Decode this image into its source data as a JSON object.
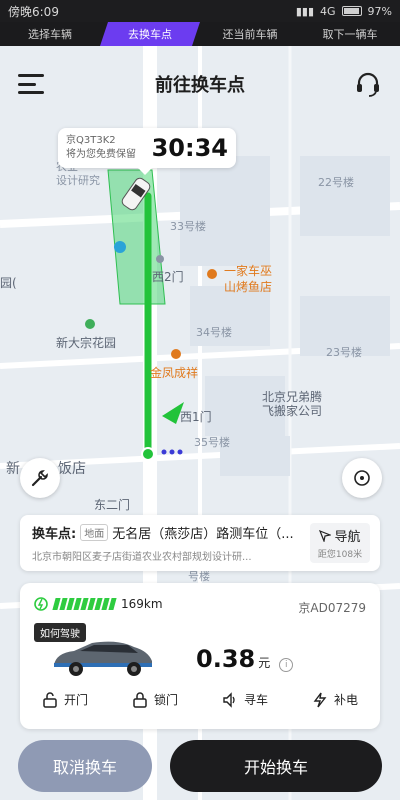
{
  "status_bar": {
    "time": "傍晚6:09",
    "network": "4G",
    "battery": "97%"
  },
  "steps": [
    {
      "label": "选择车辆",
      "active": false
    },
    {
      "label": "去换车点",
      "active": true
    },
    {
      "label": "还当前车辆",
      "active": false
    },
    {
      "label": "取下一辆车",
      "active": false
    }
  ],
  "header": {
    "title": "前往换车点",
    "menu_icon": "menu-icon",
    "support_icon": "headset-icon"
  },
  "timer": {
    "plate": "京Q3T3K2",
    "note": "将为您免费保留",
    "countdown": "30:34"
  },
  "map_labels": {
    "agri": "农业",
    "design": "设计研究",
    "building22": "22号楼",
    "building33": "33号楼",
    "west2gate": "西2门",
    "restaurant1": "一家车巫",
    "restaurant1b": "山烤鱼店",
    "garden": "园(",
    "new_garden": "新大宗花园",
    "building34": "34号楼",
    "building23": "23号楼",
    "jinfeng": "金凤成祥",
    "west1gate": "西1门",
    "movers1": "北京兄弟腾",
    "movers2": "飞搬家公司",
    "building35": "35号楼",
    "hotel": "新",
    "hotel2": "饭店",
    "east2gate": "东二门",
    "bottom_misc": "号楼"
  },
  "swap_point": {
    "label": "换车点:",
    "tag": "地面",
    "name": "无名居（燕莎店）路测车位（...",
    "address": "北京市朝阳区麦子店街道农业农村部规划设计研...",
    "nav_label": "导航",
    "distance": "距您108米"
  },
  "car": {
    "battery_bars": 9,
    "range": "169km",
    "plate": "京AD07279",
    "how_to_drive": "如何驾驶",
    "price": "0.38",
    "price_unit": "元",
    "actions": [
      {
        "label": "开门",
        "icon": "unlock-icon"
      },
      {
        "label": "锁门",
        "icon": "lock-icon"
      },
      {
        "label": "寻车",
        "icon": "speaker-icon"
      },
      {
        "label": "补电",
        "icon": "charge-icon"
      }
    ]
  },
  "buttons": {
    "cancel": "取消换车",
    "start": "开始换车"
  },
  "colors": {
    "accent_purple": "#6c3cf0",
    "route_green": "#22c33a",
    "dark": "#1c1c1e",
    "cancel_grey": "#8f9ab4"
  }
}
